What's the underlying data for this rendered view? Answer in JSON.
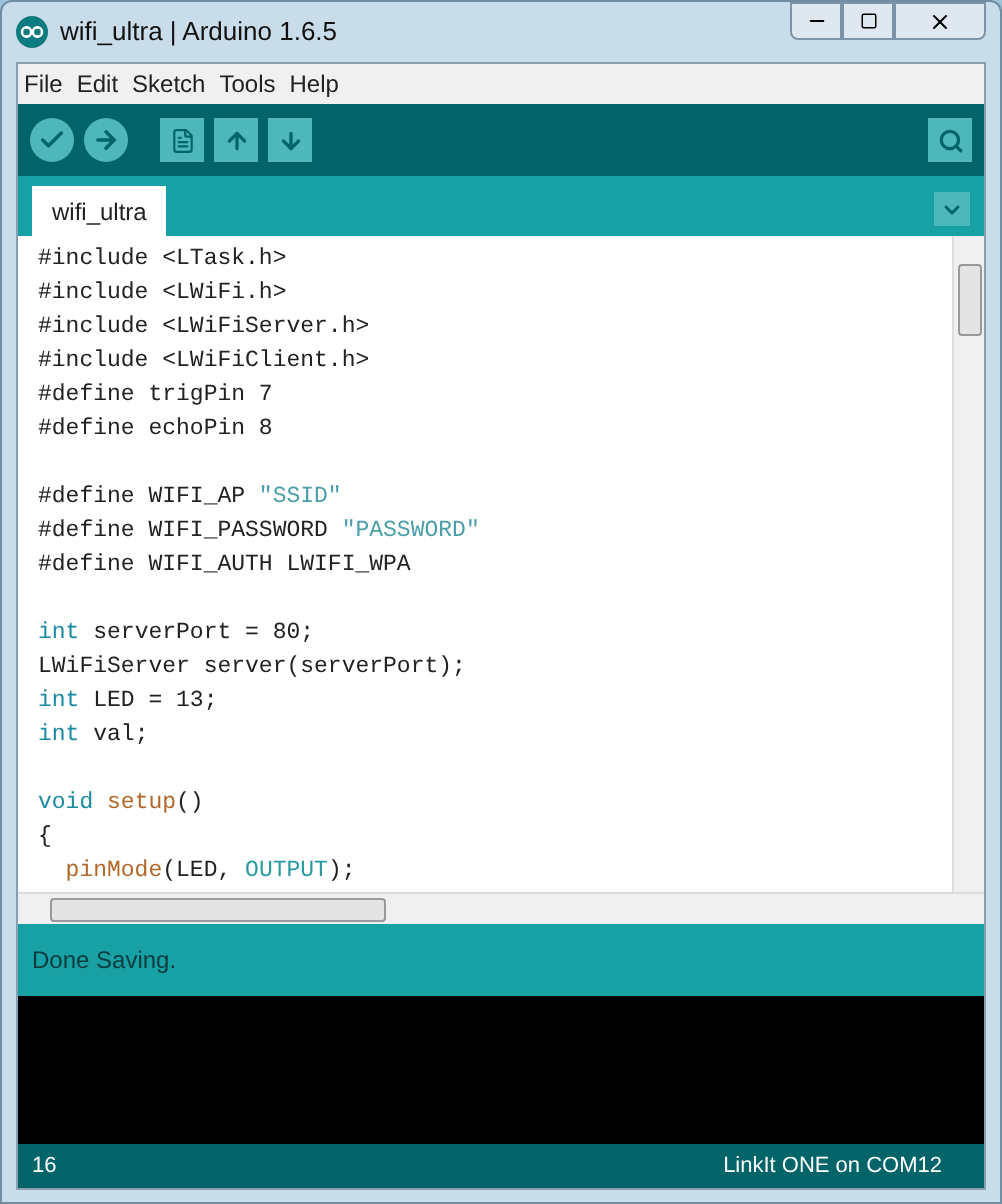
{
  "window": {
    "title": "wifi_ultra | Arduino 1.6.5"
  },
  "menu": [
    "File",
    "Edit",
    "Sketch",
    "Tools",
    "Help"
  ],
  "tabs": [
    {
      "label": "wifi_ultra",
      "selected": true
    }
  ],
  "code": [
    {
      "kind": "code",
      "tokens": [
        {
          "t": "#include <LTask.h>",
          "kind": "plain"
        }
      ]
    },
    {
      "kind": "code",
      "tokens": [
        {
          "t": "#include <LWiFi.h>",
          "kind": "plain"
        }
      ]
    },
    {
      "kind": "code",
      "tokens": [
        {
          "t": "#include <LWiFiServer.h>",
          "kind": "plain"
        }
      ]
    },
    {
      "kind": "code",
      "tokens": [
        {
          "t": "#include <LWiFiClient.h>",
          "kind": "plain"
        }
      ]
    },
    {
      "kind": "code",
      "tokens": [
        {
          "t": "#define trigPin 7",
          "kind": "plain"
        }
      ]
    },
    {
      "kind": "code",
      "tokens": [
        {
          "t": "#define echoPin 8",
          "kind": "plain"
        }
      ]
    },
    {
      "kind": "blank"
    },
    {
      "kind": "code",
      "tokens": [
        {
          "t": "#define WIFI_AP ",
          "kind": "plain"
        },
        {
          "t": "\"SSID\"",
          "kind": "string"
        }
      ]
    },
    {
      "kind": "code",
      "tokens": [
        {
          "t": "#define WIFI_PASSWORD ",
          "kind": "plain"
        },
        {
          "t": "\"PASSWORD\"",
          "kind": "string"
        }
      ]
    },
    {
      "kind": "code",
      "tokens": [
        {
          "t": "#define WIFI_AUTH LWIFI_WPA",
          "kind": "plain"
        }
      ]
    },
    {
      "kind": "blank"
    },
    {
      "kind": "code",
      "tokens": [
        {
          "t": "int",
          "kind": "keyword"
        },
        {
          "t": " serverPort = 80;",
          "kind": "plain"
        }
      ]
    },
    {
      "kind": "code",
      "tokens": [
        {
          "t": "LWiFiServer server(serverPort);",
          "kind": "plain"
        }
      ]
    },
    {
      "kind": "code",
      "tokens": [
        {
          "t": "int",
          "kind": "keyword"
        },
        {
          "t": " LED = 13;",
          "kind": "plain"
        }
      ]
    },
    {
      "kind": "code",
      "tokens": [
        {
          "t": "int",
          "kind": "keyword"
        },
        {
          "t": " val;",
          "kind": "plain"
        }
      ]
    },
    {
      "kind": "blank"
    },
    {
      "kind": "code",
      "tokens": [
        {
          "t": "void",
          "kind": "keyword"
        },
        {
          "t": " setup",
          "kind": "function"
        },
        {
          "t": "()",
          "kind": "plain"
        }
      ]
    },
    {
      "kind": "code",
      "tokens": [
        {
          "t": "{",
          "kind": "plain"
        }
      ]
    },
    {
      "kind": "code",
      "tokens": [
        {
          "t": "  pinMode",
          "kind": "function"
        },
        {
          "t": "(LED, ",
          "kind": "plain"
        },
        {
          "t": "OUTPUT",
          "kind": "constant"
        },
        {
          "t": ");",
          "kind": "plain"
        }
      ]
    }
  ],
  "status": {
    "message": "Done Saving."
  },
  "status_bar": {
    "line": "16",
    "board": "LinkIt ONE on COM12"
  }
}
